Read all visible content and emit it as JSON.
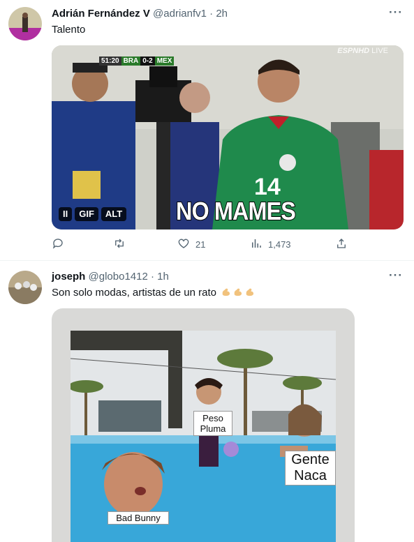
{
  "tweets": [
    {
      "author_name": "Adrián Fernández V",
      "handle": "@adrianfv1",
      "separator": "·",
      "time": "2h",
      "text": "Talento",
      "media": {
        "caption": "NO MAMES",
        "scorebug": [
          "51:20",
          "BRA",
          "0-2",
          "MEX"
        ],
        "watermark_brand": "ESPNHD",
        "watermark_live": "LIVE",
        "pills": [
          "II",
          "GIF",
          "ALT"
        ]
      },
      "actions": {
        "replies": "",
        "retweets": "",
        "likes": "21",
        "views": "1,473"
      }
    },
    {
      "author_name": "joseph",
      "handle": "@globo1412",
      "separator": "·",
      "time": "1h",
      "text": "Son solo modas, artistas de un rato",
      "emoji": [
        "flexed-biceps",
        "flexed-biceps",
        "flexed-biceps"
      ],
      "media": {
        "labels": {
          "top": "Peso Pluma",
          "right": "Gente Naca",
          "bottom": "Bad Bunny"
        }
      }
    }
  ],
  "colors": {
    "text_primary": "#0f1419",
    "text_secondary": "#536471",
    "divider": "#eff3f4",
    "jersey_green": "#1f8a4c"
  },
  "icons": [
    "more-icon",
    "reply-icon",
    "retweet-icon",
    "like-icon",
    "views-icon",
    "share-icon"
  ]
}
